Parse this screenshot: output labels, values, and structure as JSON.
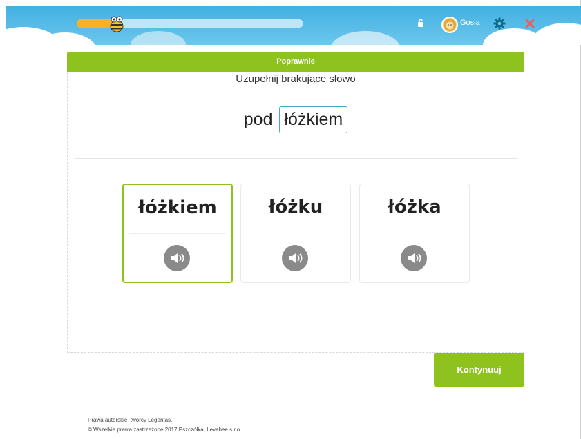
{
  "header": {
    "progress_percent": 18,
    "username": "Gosia",
    "icons": [
      "bee-mascot-icon",
      "lock-icon",
      "avatar-lion",
      "gear-icon",
      "close-icon"
    ],
    "colors": {
      "sky": "#43b0e2",
      "progress": "#f6b220",
      "gear": "#0f6b8a",
      "close": "#e86060"
    }
  },
  "exercise": {
    "status": "Poprawnie",
    "instruction": "Uzupełnij brakujące słowo",
    "sentence_prefix": "pod",
    "filled_answer": "łóżkiem",
    "options": [
      {
        "word": "łóżkiem",
        "selected": true
      },
      {
        "word": "łóżku",
        "selected": false
      },
      {
        "word": "łóżka",
        "selected": false
      }
    ],
    "continue_label": "Kontynuuj",
    "colors": {
      "accent": "#8ec21f",
      "answer_border": "#4aa8c9"
    }
  },
  "footer": {
    "line1": "Prawa autorskie: twórcy Legentas.",
    "line2": "© Wszelkie prawa zastrzeżone 2017 Pszczółka, Levebee s.r.o."
  }
}
